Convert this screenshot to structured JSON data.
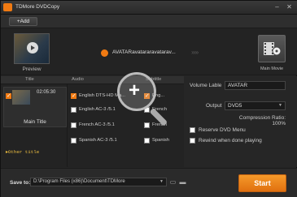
{
  "window": {
    "title": "TDMore DVDCopy",
    "minimize_icon": "minimize-icon",
    "close_icon": "close-icon"
  },
  "toolbar": {
    "add_label": "+Add"
  },
  "source": {
    "preview_label": "Preview",
    "disc_name": "AVATARavatararavatarav...",
    "main_movie_label": "Main Movie"
  },
  "columns": {
    "title": "Title",
    "audio": "Audio",
    "subtitle": "Subtitle"
  },
  "titles": [
    {
      "duration": "02:05:30",
      "label": "Main Title",
      "checked": true
    }
  ],
  "other_title": "Other title",
  "audio_tracks": [
    {
      "label": "English DTS-HD Ma...",
      "checked": true
    },
    {
      "label": "English AC-3 /5.1",
      "checked": false
    },
    {
      "label": "French AC-3 /5.1",
      "checked": false
    },
    {
      "label": "Spanish AC-3 /5.1",
      "checked": false
    }
  ],
  "subtitle_tracks": [
    {
      "label": "Eng...",
      "checked": true
    },
    {
      "label": "French",
      "checked": false
    },
    {
      "label": "French",
      "checked": false
    },
    {
      "label": "Spanish",
      "checked": false
    }
  ],
  "settings": {
    "volume_label_caption": "Volume Lable",
    "volume_label_value": "AVATAR",
    "output_caption": "Output",
    "output_value": "DVD5",
    "compression_ratio": "Compression Ratio: 100%",
    "reserve_menu_label": "Reserve DVD Menu",
    "rewind_label": "Rewind when done playing"
  },
  "bottom": {
    "save_to_label": "Save to:",
    "save_path": "D:\\Program Files (x86)\\Document\\TDMore",
    "start_label": "Start"
  }
}
